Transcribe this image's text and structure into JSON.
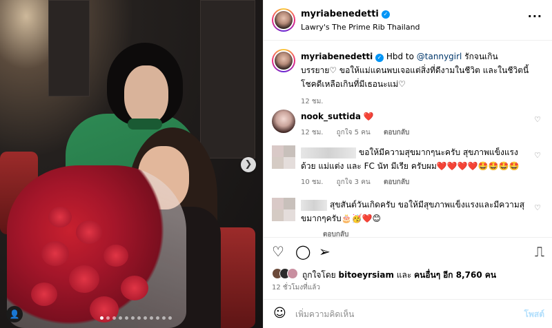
{
  "post": {
    "username": "myriabenedetti",
    "location": "Lawry's The Prime Rib Thailand",
    "more_icon": "more-horizontal-icon"
  },
  "caption": {
    "username": "myriabenedetti",
    "prefix": "Hbd to",
    "mention": "@tannygirl",
    "text": "รักจนเกินบรรยาย♡ ขอให้แม่แดนพบเจอแต่สิ่งที่ดีงามในชีวิต และในชีวิตนี้โชคดีเหลือเกินที่มีเธอนะแม่♡",
    "time": "12 ชม."
  },
  "comments": [
    {
      "username": "nook_suttida",
      "text": "❤️",
      "time": "12 ชม.",
      "likes": "ถูกใจ 5 คน",
      "reply": "ตอบกลับ"
    },
    {
      "username": "",
      "text": "ขอให้มีความสุขมากๆนะครับ สุขภาพแข็งแรง ด้วย แม่แต่ง และ FC นัท มีเรีย ครับผม❤️❤️❤️❤️🤩🤩🤩🤩",
      "time": "10 ชม.",
      "likes": "ถูกใจ 3 คน",
      "reply": "ตอบกลับ"
    },
    {
      "username": "",
      "text": "สุขสันต์วันเกิดครับ ขอให้มีสุขภาพแข็งแรงและมีความสุขมากๆครับ🎂🥳❤️😊",
      "time": "",
      "likes": "",
      "reply": "ตอบกลับ"
    }
  ],
  "liked_by": {
    "prefix": "ถูกใจโดย",
    "user": "bitoeyrsiam",
    "middle": "และ",
    "others_bold": "คนอื่นๆ",
    "suffix": "อีก 8,760 คน"
  },
  "posted_time": "12 ชั่วโมงที่แล้ว",
  "add_comment": {
    "placeholder": "เพิ่มความคิดเห็น",
    "post_label": "โพสต์"
  },
  "icons": {
    "like": "heart-icon",
    "comment": "comment-icon",
    "share": "send-icon",
    "save": "bookmark-icon",
    "emoji": "emoji-icon",
    "next": "chevron-right-icon",
    "tag": "user-tag-icon"
  },
  "colors": {
    "link": "#00376b",
    "verified": "#0095f6",
    "muted": "#737373",
    "post_disabled": "#b2dffc"
  },
  "carousel": {
    "slides": 12,
    "active_index": 0
  }
}
